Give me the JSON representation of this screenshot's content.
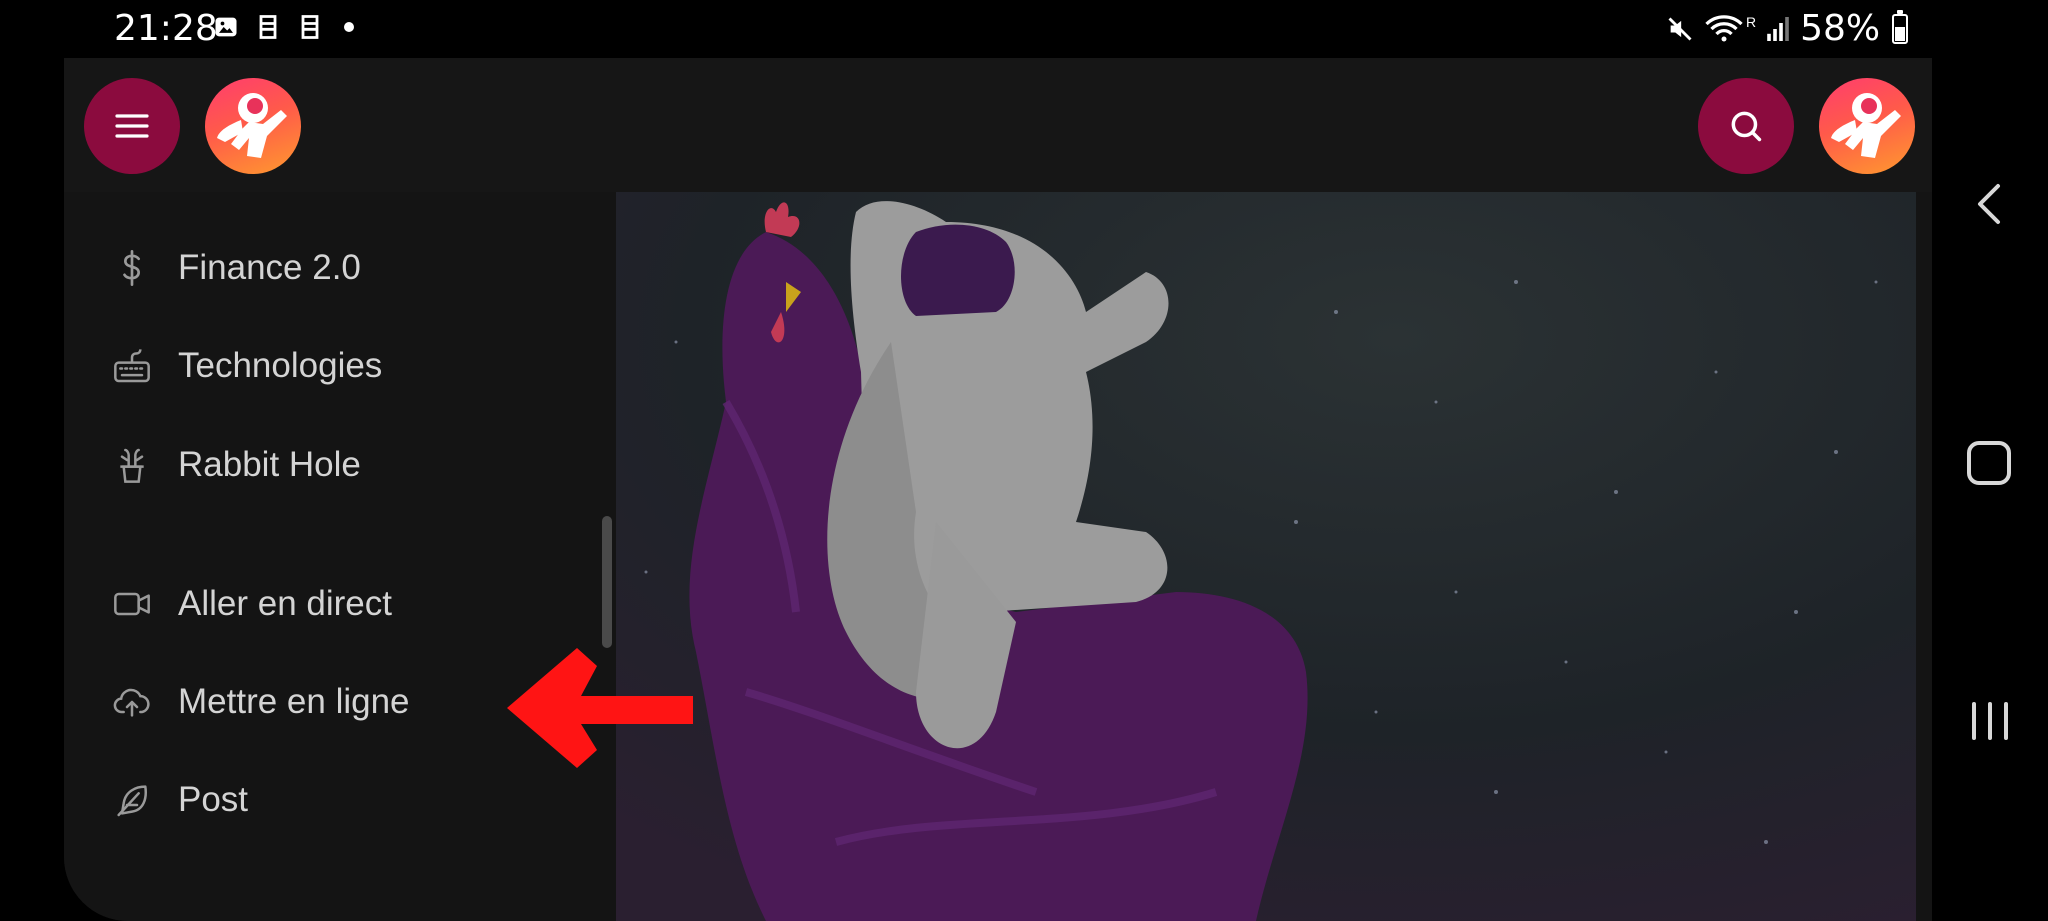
{
  "status_bar": {
    "time": "21:28",
    "left_icons": [
      "gallery-icon",
      "notes-icon",
      "notes-icon",
      "dot"
    ],
    "right_icons": [
      "mute-icon",
      "wifi-icon",
      "signal-icon"
    ],
    "roaming_indicator": "R",
    "battery": "58%",
    "battery_level": 0.58
  },
  "topbar": {
    "menu_icon": "hamburger-menu-icon",
    "logo": "astronaut-avatar",
    "search_icon": "search-icon",
    "profile": "astronaut-avatar"
  },
  "sidebar": {
    "items": [
      {
        "label": "Finance 2.0",
        "icon": "dollar-icon"
      },
      {
        "label": "Technologies",
        "icon": "keyboard-icon"
      },
      {
        "label": "Rabbit Hole",
        "icon": "magic-hat-icon"
      },
      {
        "label": "Aller en direct",
        "icon": "video-camera-icon"
      },
      {
        "label": "Mettre en ligne",
        "icon": "cloud-upload-icon"
      },
      {
        "label": "Post",
        "icon": "feather-icon"
      }
    ]
  },
  "annotation": {
    "arrow_color": "#ff1414"
  },
  "colors": {
    "accent": "#8b0b3e",
    "background": "#141414",
    "text": "#d4d4d4",
    "icon": "#9a9a9a"
  },
  "android_nav": [
    "back-icon",
    "home-icon",
    "recents-icon"
  ]
}
